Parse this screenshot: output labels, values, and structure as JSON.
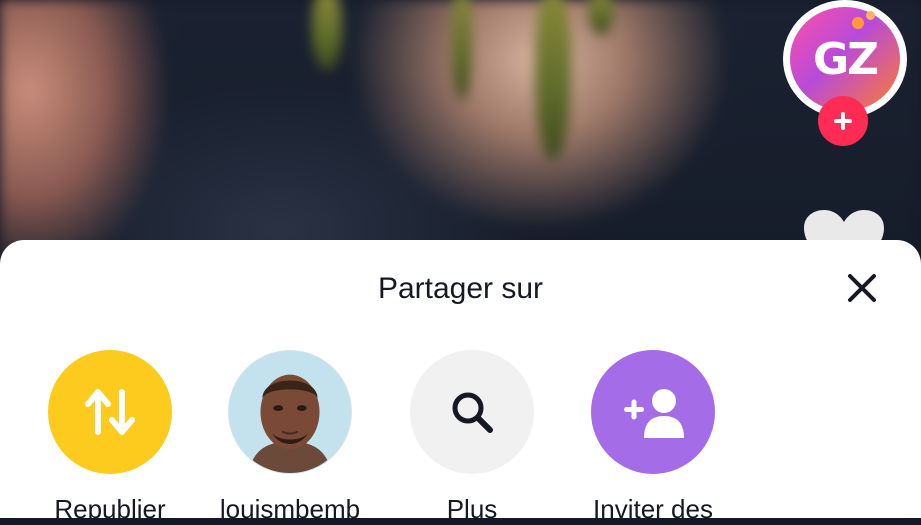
{
  "creator": {
    "logo_text": "GZ"
  },
  "sheet": {
    "title": "Partager sur",
    "items": [
      {
        "label": "Republier",
        "icon": "repost-icon",
        "color": "#fdcb1d"
      },
      {
        "label": "louismbemb",
        "icon": "contact-avatar",
        "color": "#bfe0ec"
      },
      {
        "label": "Plus",
        "icon": "search-icon",
        "color": "#f1f1f2"
      },
      {
        "label": "Inviter des",
        "icon": "add-friend-icon",
        "color": "#a56ce8"
      }
    ]
  },
  "colors": {
    "follow_plus": "#fe2c55",
    "text": "#161823"
  }
}
